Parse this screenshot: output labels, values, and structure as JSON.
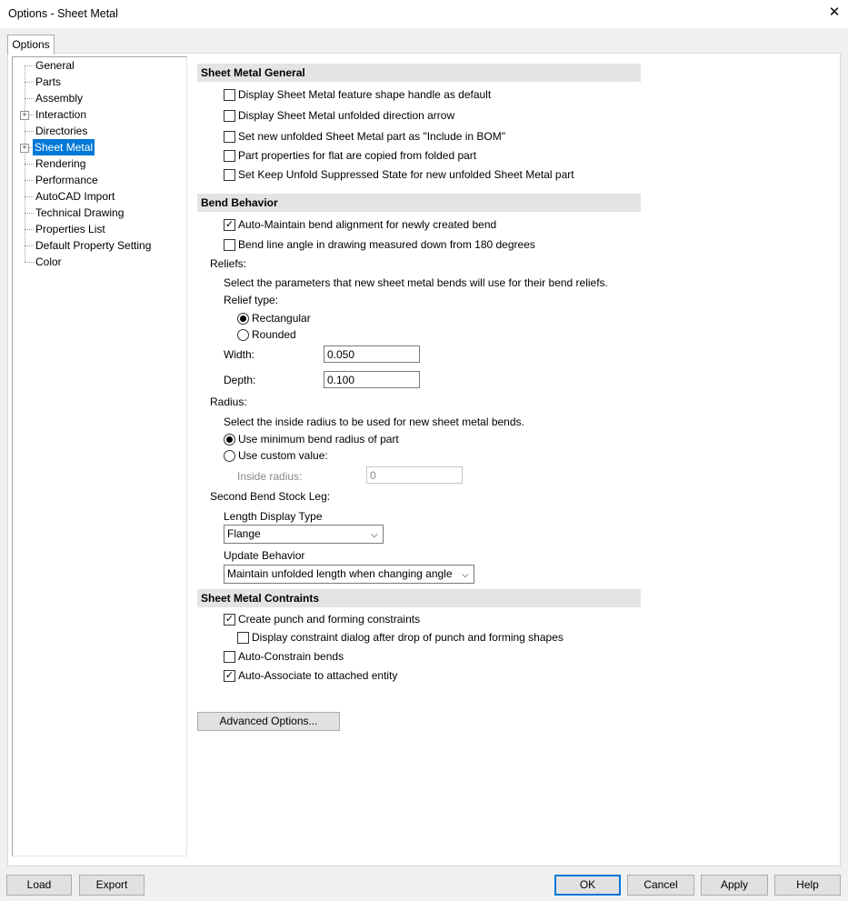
{
  "window": {
    "title": "Options - Sheet Metal",
    "close_glyph": "✕"
  },
  "tabs": [
    {
      "label": "Options"
    }
  ],
  "tree": {
    "items": [
      {
        "label": "General",
        "expandable": false,
        "selected": false
      },
      {
        "label": "Parts",
        "expandable": false,
        "selected": false
      },
      {
        "label": "Assembly",
        "expandable": false,
        "selected": false
      },
      {
        "label": "Interaction",
        "expandable": true,
        "selected": false
      },
      {
        "label": "Directories",
        "expandable": false,
        "selected": false
      },
      {
        "label": "Sheet Metal",
        "expandable": true,
        "selected": true
      },
      {
        "label": "Rendering",
        "expandable": false,
        "selected": false
      },
      {
        "label": "Performance",
        "expandable": false,
        "selected": false
      },
      {
        "label": "AutoCAD Import",
        "expandable": false,
        "selected": false
      },
      {
        "label": "Technical Drawing",
        "expandable": false,
        "selected": false
      },
      {
        "label": "Properties List",
        "expandable": false,
        "selected": false
      },
      {
        "label": "Default Property Setting",
        "expandable": false,
        "selected": false
      },
      {
        "label": "Color",
        "expandable": false,
        "selected": false
      }
    ],
    "expander_glyph": "+"
  },
  "general": {
    "title": "Sheet Metal General",
    "options": [
      {
        "label": "Display Sheet Metal feature shape handle as default",
        "checked": false
      },
      {
        "label": "Display Sheet Metal unfolded direction arrow",
        "checked": false
      },
      {
        "label": "Set new unfolded Sheet Metal part as \"Include in BOM\"",
        "checked": false
      },
      {
        "label": "Part properties for flat are copied from folded part",
        "checked": false
      },
      {
        "label": "Set Keep Unfold Suppressed State for new unfolded Sheet Metal part",
        "checked": false
      }
    ]
  },
  "bend": {
    "title": "Bend Behavior",
    "options": [
      {
        "label": "Auto-Maintain bend alignment for newly created bend",
        "checked": true
      },
      {
        "label": "Bend line angle in drawing measured down from 180 degrees",
        "checked": false
      }
    ],
    "reliefs": {
      "label": "Reliefs:",
      "description": "Select the parameters that new sheet metal bends will use for their bend reliefs.",
      "type_label": "Relief type:",
      "types": [
        {
          "label": "Rectangular",
          "selected": true
        },
        {
          "label": "Rounded",
          "selected": false
        }
      ],
      "width_label": "Width:",
      "width_value": "0.050",
      "depth_label": "Depth:",
      "depth_value": "0.100"
    },
    "radius": {
      "label": "Radius:",
      "description": "Select the inside radius to be used for new sheet metal bends.",
      "options": [
        {
          "label": "Use minimum bend radius of part",
          "selected": true
        },
        {
          "label": "Use custom value:",
          "selected": false
        }
      ],
      "inside_label": "Inside radius:",
      "inside_value": "0"
    },
    "second_leg": {
      "label": "Second Bend Stock Leg:",
      "length_label": "Length Display Type",
      "length_value": "Flange",
      "update_label": "Update Behavior",
      "update_value": "Maintain unfolded length when changing angle"
    }
  },
  "constraints": {
    "title": "Sheet Metal Contraints",
    "options": [
      {
        "label": "Create punch and forming constraints",
        "checked": true
      },
      {
        "label": "Display constraint dialog after drop of punch and forming shapes",
        "checked": false
      },
      {
        "label": "Auto-Constrain bends",
        "checked": false
      },
      {
        "label": "Auto-Associate to attached entity",
        "checked": true
      }
    ]
  },
  "advanced_button": "Advanced Options...",
  "footer": {
    "load": "Load",
    "export": "Export",
    "ok": "OK",
    "cancel": "Cancel",
    "apply": "Apply",
    "help": "Help"
  },
  "glyphs": {
    "check": "✓",
    "dropdown": "⌵"
  }
}
